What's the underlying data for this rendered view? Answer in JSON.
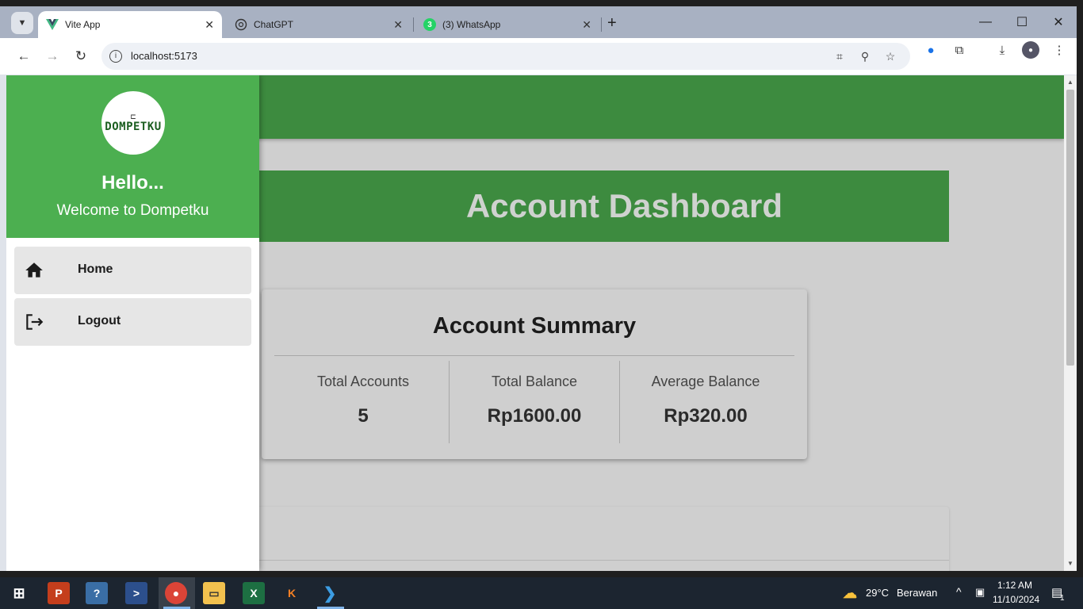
{
  "browser": {
    "tabs": [
      {
        "title": "Vite App",
        "icon": "vue-icon",
        "active": true
      },
      {
        "title": "ChatGPT",
        "icon": "chatgpt-icon",
        "active": false
      },
      {
        "title": "(3) WhatsApp",
        "icon": "whatsapp-icon",
        "active": false,
        "badge": "3"
      }
    ],
    "url": "localhost:5173"
  },
  "app": {
    "drawer": {
      "logo_text": "DOMPETKU",
      "greeting": "Hello...",
      "welcome": "Welcome to Dompetku",
      "nav": [
        {
          "label": "Home",
          "icon": "home-icon"
        },
        {
          "label": "Logout",
          "icon": "logout-icon"
        }
      ]
    },
    "dashboard_title": "Account Dashboard",
    "summary": {
      "title": "Account Summary",
      "stats": [
        {
          "label": "Total Accounts",
          "value": "5"
        },
        {
          "label": "Total Balance",
          "value": "Rp1600.00"
        },
        {
          "label": "Average Balance",
          "value": "Rp320.00"
        }
      ]
    },
    "colors": {
      "primary": "#4caf50",
      "primary_dark": "#3d8b3f",
      "overlay": "#cfcfcf"
    }
  },
  "taskbar": {
    "weather_temp": "29°C",
    "weather_text": "Berawan",
    "time": "1:12 AM",
    "date": "11/10/2024",
    "notification_count": "1"
  }
}
